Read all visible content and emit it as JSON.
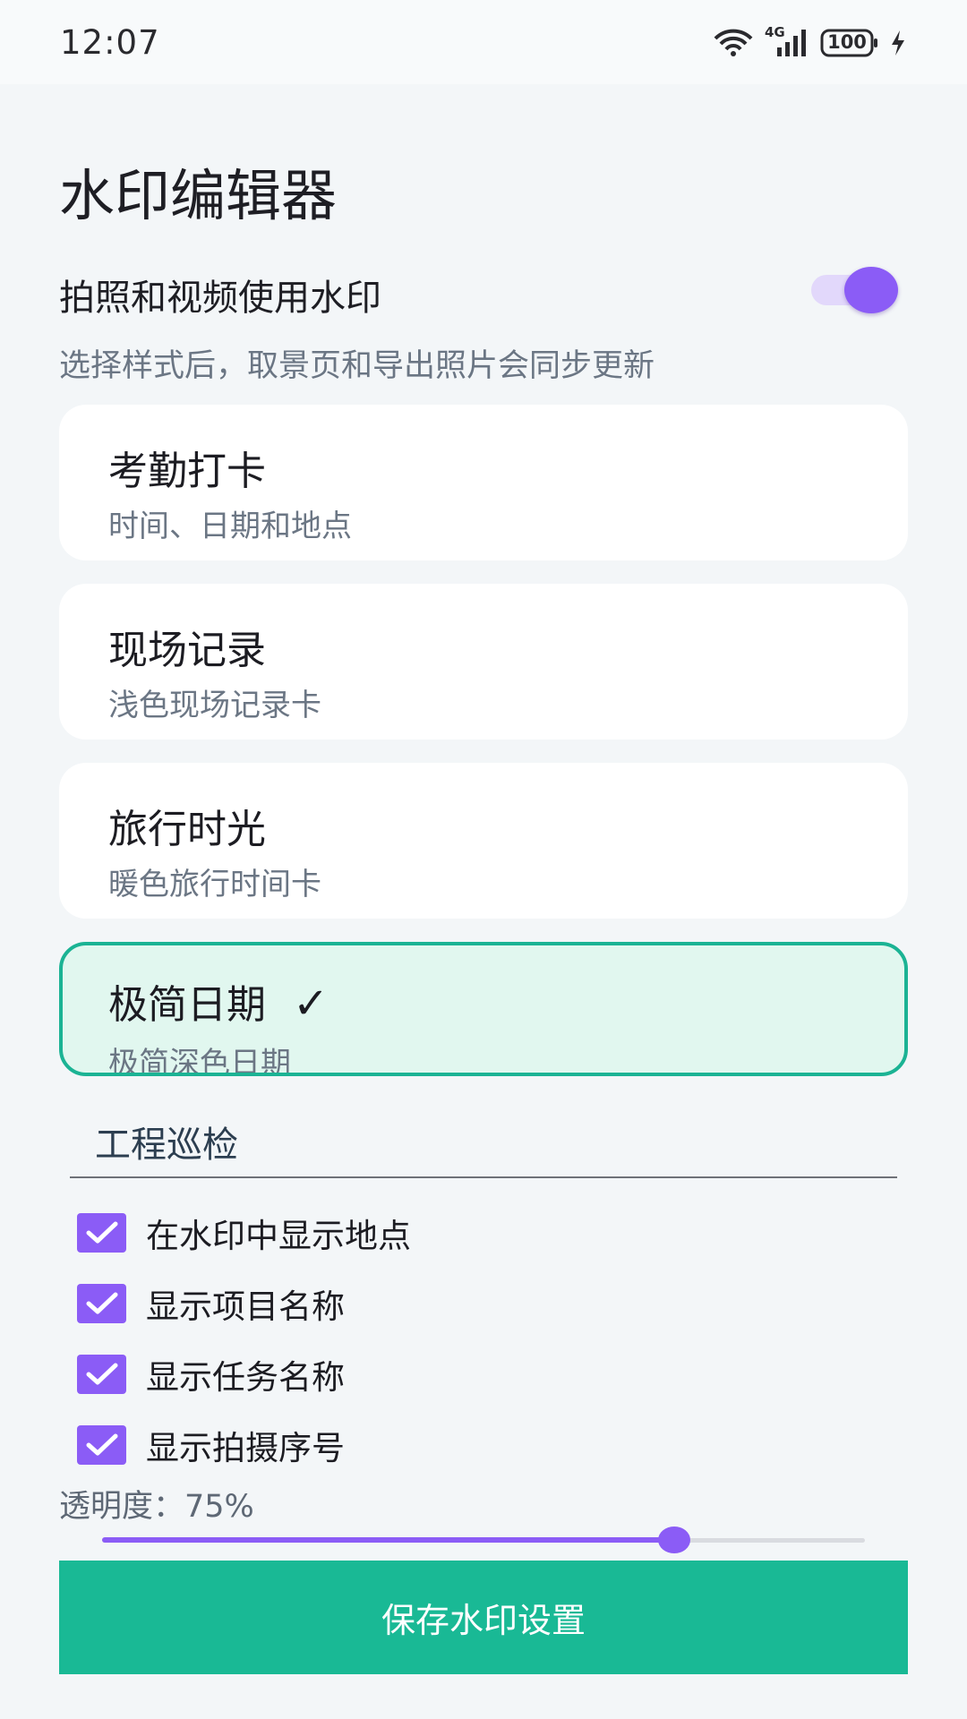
{
  "status_bar": {
    "time": "12:07",
    "network": "4G",
    "battery": "100",
    "icons": [
      "wifi-icon",
      "signal-icon",
      "battery-icon",
      "charging-icon"
    ]
  },
  "page": {
    "title": "水印编辑器"
  },
  "watermark_toggle": {
    "label": "拍照和视频使用水印",
    "enabled": true
  },
  "hint": "选择样式后，取景页和导出照片会同步更新",
  "styles": [
    {
      "title": "考勤打卡",
      "desc": "时间、日期和地点",
      "selected": false
    },
    {
      "title": "现场记录",
      "desc": "浅色现场记录卡",
      "selected": false
    },
    {
      "title": "旅行时光",
      "desc": "暖色旅行时间卡",
      "selected": false
    },
    {
      "title": "极简日期",
      "desc": "极简深色日期",
      "selected": true,
      "check": "✓"
    }
  ],
  "project_field": {
    "value": "工程巡检"
  },
  "options": [
    {
      "label": "在水印中显示地点",
      "checked": true
    },
    {
      "label": "显示项目名称",
      "checked": true
    },
    {
      "label": "显示任务名称",
      "checked": true
    },
    {
      "label": "显示拍摄序号",
      "checked": true
    }
  ],
  "opacity": {
    "label": "透明度：75%",
    "value": 0.75
  },
  "save_button": {
    "label": "保存水印设置"
  },
  "colors": {
    "accent": "#8b5cf6",
    "primary_button": "#19b995",
    "selected_card_bg": "#e1f7ef",
    "selected_card_border": "#1bb394"
  }
}
